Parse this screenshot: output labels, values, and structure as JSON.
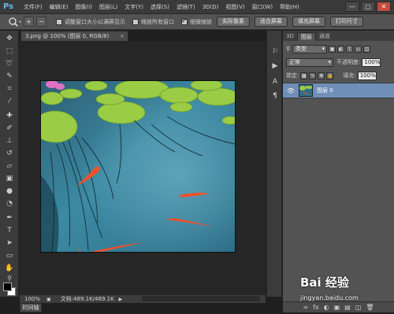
{
  "app": {
    "logo": "Ps",
    "menu": [
      "文件(F)",
      "编辑(E)",
      "图像(I)",
      "图层(L)",
      "文字(Y)",
      "选择(S)",
      "滤镜(T)",
      "3D(D)",
      "视图(V)",
      "窗口(W)",
      "帮助(H)"
    ],
    "window_controls": [
      "—",
      "▢",
      "✕"
    ]
  },
  "options": {
    "zoom_in": "+",
    "zoom_out": "−",
    "chk_resize_windows": "调整窗口大小以满屏显示",
    "chk_zoom_all": "缩放所有窗口",
    "chk_scrubby": "细微缩放",
    "btn_actual": "实际像素",
    "btn_fit": "适合屏幕",
    "btn_fill": "填充屏幕",
    "btn_print": "打印尺寸"
  },
  "document": {
    "tab_title": "3.png @ 100% (图层 0, RGB/8)",
    "tab_close": "×",
    "status_zoom": "100%",
    "status_doc": "文档:489.1K/489.1K",
    "timeline_tab": "时间轴"
  },
  "panel": {
    "tabs": [
      "3D",
      "图层",
      "通道"
    ],
    "filter_kind": "类型",
    "blend_mode": "正常",
    "opacity_label": "不透明度:",
    "opacity_value": "100%",
    "lock_label": "锁定:",
    "fill_label": "填充:",
    "fill_value": "100%",
    "layer_name": "图层 0",
    "bottom_icons": [
      "∞",
      "fx",
      "◐",
      "▣",
      "▤",
      "◫",
      "🗑"
    ]
  },
  "watermark": {
    "logo": "Bai 经验",
    "url": "jingyan.baidu.com"
  },
  "colors": {
    "water": "#2f6f86",
    "lily": "#9bcc45",
    "fish": "#f0502a",
    "accent_selected": "#6f8eb8"
  }
}
